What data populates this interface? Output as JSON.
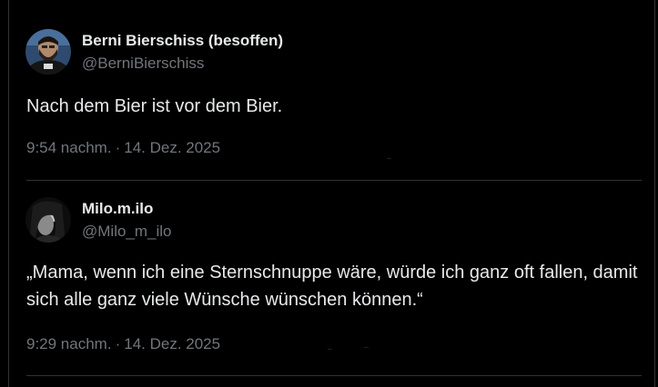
{
  "tweets": [
    {
      "display_name": "Berni Bierschiss (besoffen)",
      "handle": "@BerniBierschiss",
      "text": "Nach dem Bier ist vor dem Bier.",
      "time": "9:54 nachm.",
      "separator": "·",
      "date": "14. Dez. 2025",
      "avatar_icon": "avatar-man-beard-photo"
    },
    {
      "display_name": "Milo.m.ilo",
      "handle": "@Milo_m_ilo",
      "text": "„Mama, wenn ich eine Sternschnuppe wäre, würde ich ganz oft fallen, damit sich alle ganz viele Wünsche wünschen können.“",
      "time": "9:29 nachm.",
      "separator": "·",
      "date": "14. Dez. 2025",
      "avatar_icon": "avatar-dark-photo"
    }
  ],
  "colors": {
    "background": "#000000",
    "text_primary": "#e7e9ea",
    "text_secondary": "#71767b",
    "border": "#2f3336"
  }
}
